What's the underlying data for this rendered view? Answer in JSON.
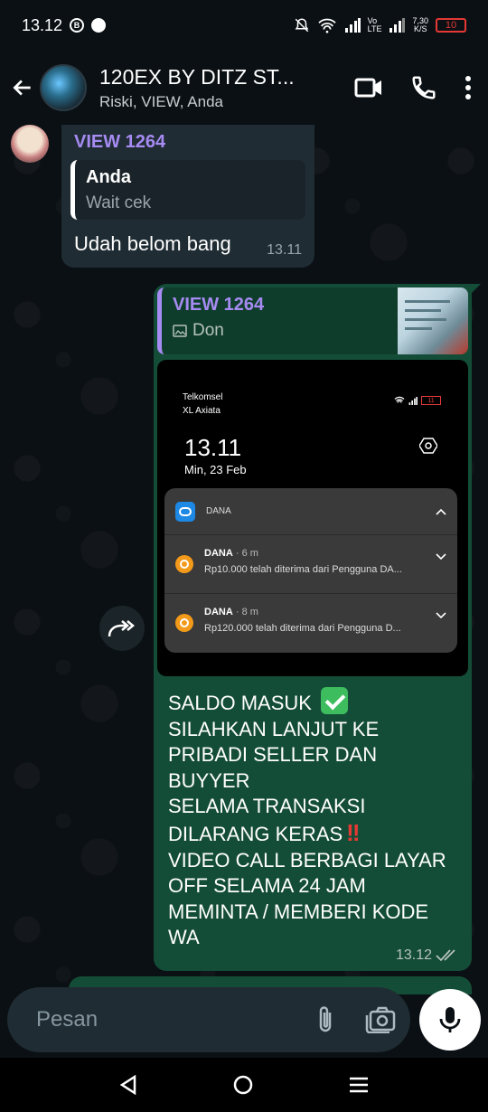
{
  "status_bar": {
    "time": "13.12",
    "speed": "7,30\nK/S",
    "battery": "10",
    "vo_lte": "Vo\nLTE"
  },
  "header": {
    "title": "120EX BY DITZ ST...",
    "subtitle": "Riski, VIEW, Anda"
  },
  "messages": {
    "incoming": {
      "sender": "VIEW 1264",
      "quote_name": "Anda",
      "quote_text": "Wait cek",
      "text": "Udah belom bang",
      "time": "13.11"
    },
    "outgoing": {
      "quote_name": "VIEW 1264",
      "quote_text": "Don",
      "screenshot": {
        "carrier1": "Telkomsel",
        "carrier2": "XL Axiata",
        "clock": "13.11",
        "date": "Min, 23 Feb",
        "battery": "11",
        "app_name": "DANA",
        "notifications": [
          {
            "title": "DANA",
            "time": "· 6 m",
            "text": "Rp10.000 telah diterima dari Pengguna DA..."
          },
          {
            "title": "DANA",
            "time": "· 8 m",
            "text": "Rp120.000 telah diterima dari Pengguna D..."
          }
        ]
      },
      "lines": [
        "SALDO MASUK",
        "SILAHKAN LANJUT KE",
        "PRIBADI SELLER DAN",
        "BUYYER",
        "SELAMA TRANSAKSI",
        "DILARANG KERAS",
        "VIDEO CALL BERBAGI LAYAR",
        "OFF SELAMA 24 JAM",
        "MEMINTA / MEMBERI KODE",
        "WA"
      ],
      "time": "13.12"
    }
  },
  "input": {
    "placeholder": "Pesan"
  },
  "icons": {
    "back": "arrow-left-icon",
    "video": "video-camera-icon",
    "call": "phone-icon",
    "menu": "more-vertical-icon",
    "sticker": "sticker-icon",
    "attach": "paperclip-icon",
    "camera": "camera-icon",
    "mic": "mic-icon",
    "forward": "forward-icon"
  },
  "colors": {
    "outgoing_bubble": "#144d37",
    "incoming_bubble": "#202c33",
    "sender_name": "#a58bf2",
    "background": "#0b1014"
  }
}
